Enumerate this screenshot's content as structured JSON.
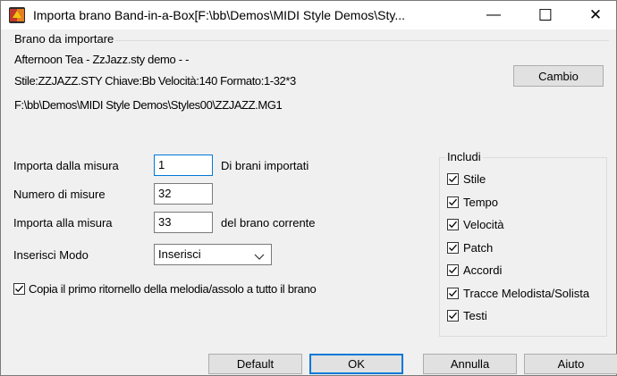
{
  "window": {
    "title": "Importa brano Band-in-a-Box[F:\\bb\\Demos\\MIDI Style Demos\\Sty...",
    "minimize_glyph": "—",
    "maximize_glyph": "☐",
    "close_glyph": "✕"
  },
  "song_group": {
    "legend": "Brano da importare",
    "song_title": "Afternoon Tea - ZzJazz.sty demo - -",
    "info_line": "Stile:ZZJAZZ.STY  Chiave:Bb  Velocità:140  Formato:1-32*3",
    "path": "F:\\bb\\Demos\\MIDI Style Demos\\Styles00\\ZZJAZZ.MG1",
    "change_button": "Cambio"
  },
  "options": {
    "import_from_label": "Importa dalla misura",
    "import_from_value": "1",
    "import_from_suffix": "Di brani importati",
    "num_bars_label": "Numero di misure",
    "num_bars_value": "32",
    "import_to_label": "Importa alla misura",
    "import_to_value": "33",
    "import_to_suffix": "del brano corrente",
    "insert_mode_label": "Inserisci Modo",
    "insert_mode_value": "Inserisci",
    "copy_first_chorus_label": "Copia il primo ritornello della melodia/assolo a tutto il brano",
    "copy_first_chorus_checked": true
  },
  "include": {
    "legend": "Includi",
    "items": [
      {
        "label": "Stile",
        "checked": true
      },
      {
        "label": "Tempo",
        "checked": true
      },
      {
        "label": "Velocità",
        "checked": true
      },
      {
        "label": "Patch",
        "checked": true
      },
      {
        "label": "Accordi",
        "checked": true
      },
      {
        "label": "Tracce Melodista/Solista",
        "checked": true
      },
      {
        "label": "Testi",
        "checked": true
      }
    ]
  },
  "buttons": {
    "default": "Default",
    "ok": "OK",
    "cancel": "Annulla",
    "help": "Aiuto"
  }
}
